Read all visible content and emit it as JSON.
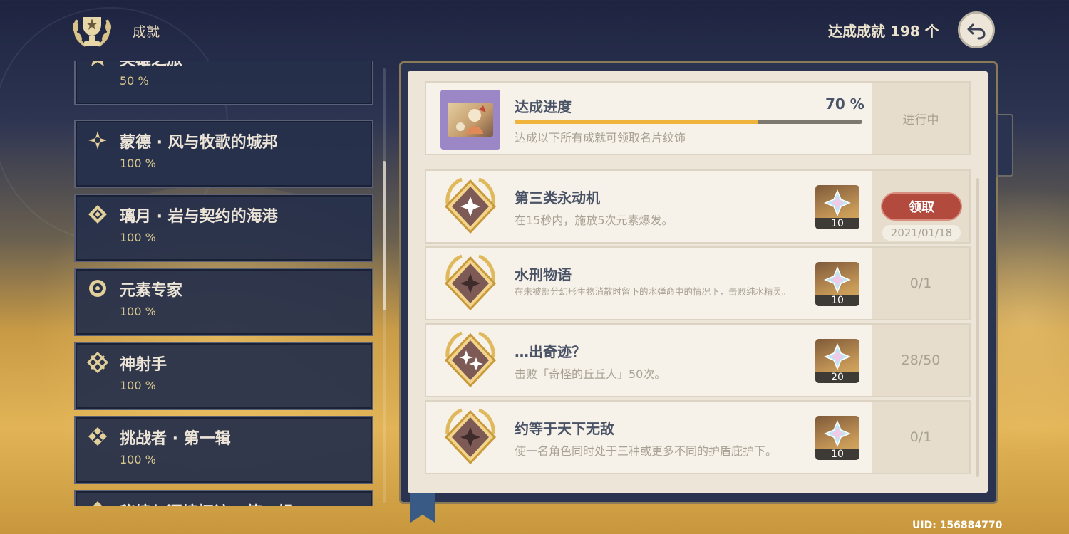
{
  "header": {
    "title": "成就",
    "achievement_count": "达成成就 198 个",
    "trophy_icon": "trophy-laurel-icon",
    "back_icon": "back-arrow-icon"
  },
  "categories": [
    {
      "name": "英雄之旅",
      "percent": "50 %",
      "icon": "star-badge-icon"
    },
    {
      "name": "蒙德 · 风与牧歌的城邦",
      "percent": "100 %",
      "icon": "mondstadt-icon"
    },
    {
      "name": "璃月 · 岩与契约的海港",
      "percent": "100 %",
      "icon": "liyue-icon"
    },
    {
      "name": "元素专家",
      "percent": "100 %",
      "icon": "element-icon"
    },
    {
      "name": "神射手",
      "percent": "100 %",
      "icon": "marksman-icon"
    },
    {
      "name": "挑战者 · 第一辑",
      "percent": "100 %",
      "icon": "challenger-icon"
    },
    {
      "name": "秘境与洞境探访 · 第一辑",
      "percent": "",
      "icon": "domain-icon"
    }
  ],
  "progress": {
    "title": "达成进度",
    "percent_label": "70 %",
    "value": 0.7,
    "description": "达成以下所有成就可领取名片纹饰",
    "status": "进行中"
  },
  "achievements": [
    {
      "title": "第三类永动机",
      "description": "在15秒内，施放5次元素爆发。",
      "reward_qty": "10",
      "claim_label": "领取",
      "date": "2021/01/18",
      "status": ""
    },
    {
      "title": "水刑物语",
      "description": "在未被部分幻形生物消散时留下的水弹命中的情况下，击败纯水精灵。",
      "reward_qty": "10",
      "status": "0/1"
    },
    {
      "title": "…出奇迹？",
      "description": "击败「奇怪的丘丘人」50次。",
      "reward_qty": "20",
      "status": "28/50"
    },
    {
      "title": "约等于天下无敌",
      "description": "使一名角色同时处于三种或更多不同的护盾庇护下。",
      "reward_qty": "10",
      "status": "0/1"
    }
  ],
  "reward_icon": "primogem-icon",
  "uid": "UID: 156884770",
  "colors": {
    "accent_gold": "#f0b43c",
    "claim_red": "#b24a3e",
    "paper": "#ece5d8",
    "panel_dark": "#26304a"
  }
}
